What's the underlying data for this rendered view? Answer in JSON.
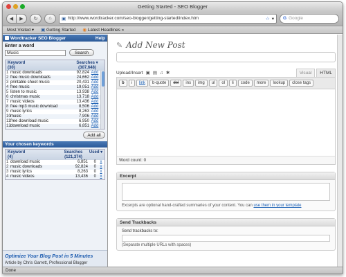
{
  "window": {
    "title": "Getting Started - SEO Blogger"
  },
  "toolbar": {
    "url": "http://www.wordtracker.com/seo-blogger/getting-started/index.htm",
    "search_placeholder": "Google",
    "back_icon": "back-arrow",
    "forward_icon": "forward-arrow",
    "reload_icon": "reload",
    "home_icon": "home"
  },
  "bookmarks": {
    "items": [
      "Most Visited ▾",
      "Getting Started",
      "Latest Headlines »"
    ]
  },
  "sidebar": {
    "header_title": "Wordtracker SEO Blogger",
    "help_label": "Help",
    "enter_label": "Enter a word",
    "input_value": "Music",
    "search_button": "Search",
    "table": {
      "col_keyword": "Keyword",
      "col_keyword_count": "(30)",
      "col_searches": "Searches ▾",
      "col_searches_total": "(307,648)",
      "rows": [
        {
          "n": "1",
          "kw": "music downloads",
          "val": "92,824",
          "add": "Add"
        },
        {
          "n": "2",
          "kw": "free music downloads",
          "val": "24,662",
          "add": "Add"
        },
        {
          "n": "3",
          "kw": "printable sheet music",
          "val": "20,431",
          "add": "Add"
        },
        {
          "n": "4",
          "kw": "free music",
          "val": "19,051",
          "add": "Add"
        },
        {
          "n": "5",
          "kw": "listen to music",
          "val": "13,938",
          "add": "Add"
        },
        {
          "n": "6",
          "kw": "christmas music",
          "val": "13,718",
          "add": "Add"
        },
        {
          "n": "7",
          "kw": "music videos",
          "val": "13,436",
          "add": "Add"
        },
        {
          "n": "8",
          "kw": "free mp3 music download",
          "val": "8,506",
          "add": "Add"
        },
        {
          "n": "9",
          "kw": "music lyrics",
          "val": "8,263",
          "add": "Add"
        },
        {
          "n": "10",
          "kw": "music",
          "val": "7,906",
          "add": "Add"
        },
        {
          "n": "11",
          "kw": "free download music",
          "val": "6,950",
          "add": "Add"
        },
        {
          "n": "12",
          "kw": "download music",
          "val": "6,851",
          "add": "Add"
        }
      ]
    },
    "add_all_button": "Add all",
    "chosen": {
      "title": "Your chosen keywords",
      "col_keyword": "Keyword",
      "col_keyword_count": "(4)",
      "col_searches": "Searches",
      "col_searches_total": "(121,374)",
      "col_used": "Used ▾",
      "rows": [
        {
          "n": "1",
          "kw": "download music",
          "val": "6,851",
          "used": "0",
          "x": "x"
        },
        {
          "n": "2",
          "kw": "music downloads",
          "val": "92,824",
          "used": "0",
          "x": "x"
        },
        {
          "n": "3",
          "kw": "music lyrics",
          "val": "8,263",
          "used": "0",
          "x": "x"
        },
        {
          "n": "4",
          "kw": "music videos",
          "val": "13,436",
          "used": "0",
          "x": "x"
        }
      ]
    },
    "promo_title": "Optimize Your Blog Post in 5 Minutes",
    "promo_byline": "Article by Chris Garrett, Professional Blogger"
  },
  "main": {
    "page_title": "Add New Post",
    "upload_label": "Upload/Insert",
    "tab_visual": "Visual",
    "tab_html": "HTML",
    "quicktags": [
      "b",
      "i",
      "link",
      "b-quote",
      "del",
      "ins",
      "img",
      "ul",
      "ol",
      "li",
      "code",
      "more",
      "lookup",
      "close tags"
    ],
    "word_count": "Word count: 0",
    "excerpt": {
      "title": "Excerpt",
      "note_prefix": "Excerpts are optional hand-crafted summaries of your content. You can ",
      "note_link": "use them in your template"
    },
    "trackbacks": {
      "title": "Send Trackbacks",
      "label": "Send trackbacks to:",
      "note": "(Separate multiple URLs with spaces)"
    }
  },
  "status": {
    "text": "Done"
  }
}
